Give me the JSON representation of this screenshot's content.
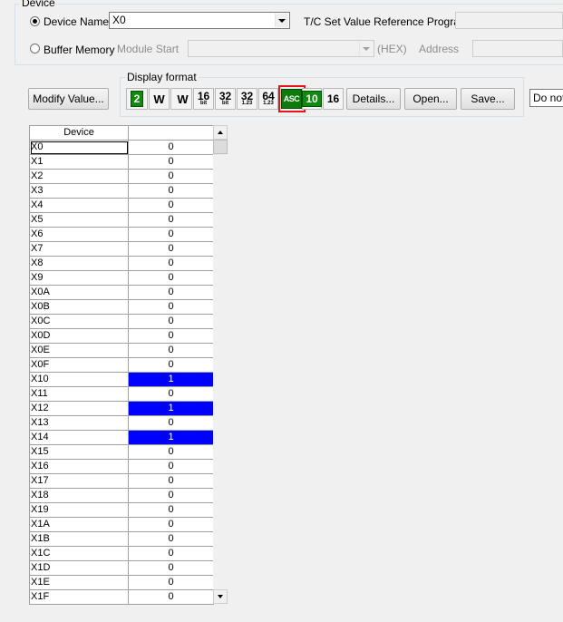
{
  "device_group": {
    "legend": "Device",
    "device_name_label": "Device Name",
    "device_name_value": "X0",
    "tc_label": "T/C Set Value Reference Program",
    "tc_value": "",
    "buffer_memory_label": "Buffer Memory",
    "module_start_label": "Module Start",
    "module_start_value": "",
    "hex_label": "(HEX)",
    "address_label": "Address",
    "address_value": ""
  },
  "toolbar": {
    "modify_value_label": "Modify Value...",
    "display_format_legend": "Display format",
    "formats": {
      "bin": "2",
      "word": "W",
      "dword": "W",
      "b16_top": "16",
      "b16_bottom": "bit",
      "b32_top": "32",
      "b32_bottom": "bit",
      "r32_top": "32",
      "r32_bottom": "1.23",
      "r64_top": "64",
      "r64_bottom": "1.23",
      "asc": "ASC",
      "dec": "10",
      "hex": "16"
    },
    "details_label": "Details...",
    "open_label": "Open...",
    "save_label": "Save...",
    "right_cut_text": "Do not"
  },
  "colors": {
    "highlight": "#0000ff",
    "asc_highlight_border": "#e8141c",
    "format_green": "#0f8a0f"
  },
  "grid": {
    "header_device": "Device",
    "header_value": "",
    "rows": [
      {
        "device": "X0",
        "value": "0"
      },
      {
        "device": "X1",
        "value": "0"
      },
      {
        "device": "X2",
        "value": "0"
      },
      {
        "device": "X3",
        "value": "0"
      },
      {
        "device": "X4",
        "value": "0"
      },
      {
        "device": "X5",
        "value": "0"
      },
      {
        "device": "X6",
        "value": "0"
      },
      {
        "device": "X7",
        "value": "0"
      },
      {
        "device": "X8",
        "value": "0"
      },
      {
        "device": "X9",
        "value": "0"
      },
      {
        "device": "X0A",
        "value": "0"
      },
      {
        "device": "X0B",
        "value": "0"
      },
      {
        "device": "X0C",
        "value": "0"
      },
      {
        "device": "X0D",
        "value": "0"
      },
      {
        "device": "X0E",
        "value": "0"
      },
      {
        "device": "X0F",
        "value": "0"
      },
      {
        "device": "X10",
        "value": "1"
      },
      {
        "device": "X11",
        "value": "0"
      },
      {
        "device": "X12",
        "value": "1"
      },
      {
        "device": "X13",
        "value": "0"
      },
      {
        "device": "X14",
        "value": "1"
      },
      {
        "device": "X15",
        "value": "0"
      },
      {
        "device": "X16",
        "value": "0"
      },
      {
        "device": "X17",
        "value": "0"
      },
      {
        "device": "X18",
        "value": "0"
      },
      {
        "device": "X19",
        "value": "0"
      },
      {
        "device": "X1A",
        "value": "0"
      },
      {
        "device": "X1B",
        "value": "0"
      },
      {
        "device": "X1C",
        "value": "0"
      },
      {
        "device": "X1D",
        "value": "0"
      },
      {
        "device": "X1E",
        "value": "0"
      },
      {
        "device": "X1F",
        "value": "0"
      }
    ]
  }
}
